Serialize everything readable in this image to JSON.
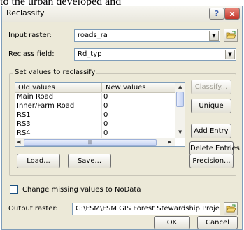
{
  "background_text": "to the urban developed and",
  "window": {
    "title": "Reclassify",
    "help_label": "?",
    "close_label": "x"
  },
  "input_raster": {
    "label": "Input raster:",
    "value": "roads_ra"
  },
  "reclass_field": {
    "label": "Reclass field:",
    "value": "Rd_typ"
  },
  "group": {
    "title": "Set values to reclassify",
    "columns": [
      "Old values",
      "New values"
    ],
    "rows": [
      {
        "old": "Main Road",
        "new": "0"
      },
      {
        "old": "Inner/Farm Road",
        "new": "0"
      },
      {
        "old": "RS1",
        "new": "0"
      },
      {
        "old": "RS3",
        "new": "0"
      },
      {
        "old": "RS4",
        "new": "0"
      }
    ],
    "buttons": {
      "classify": "Classify...",
      "unique": "Unique",
      "add_entry": "Add Entry",
      "delete_entries": "Delete Entries",
      "load": "Load...",
      "save": "Save...",
      "precision": "Precision..."
    }
  },
  "nodata_checkbox": {
    "label": "Change missing values to NoData",
    "checked": false
  },
  "output_raster": {
    "label": "Output raster:",
    "value": "G:\\FSM\\FSM GIS Forest Stewardship Project\\FSM"
  },
  "footer": {
    "ok": "OK",
    "cancel": "Cancel"
  }
}
